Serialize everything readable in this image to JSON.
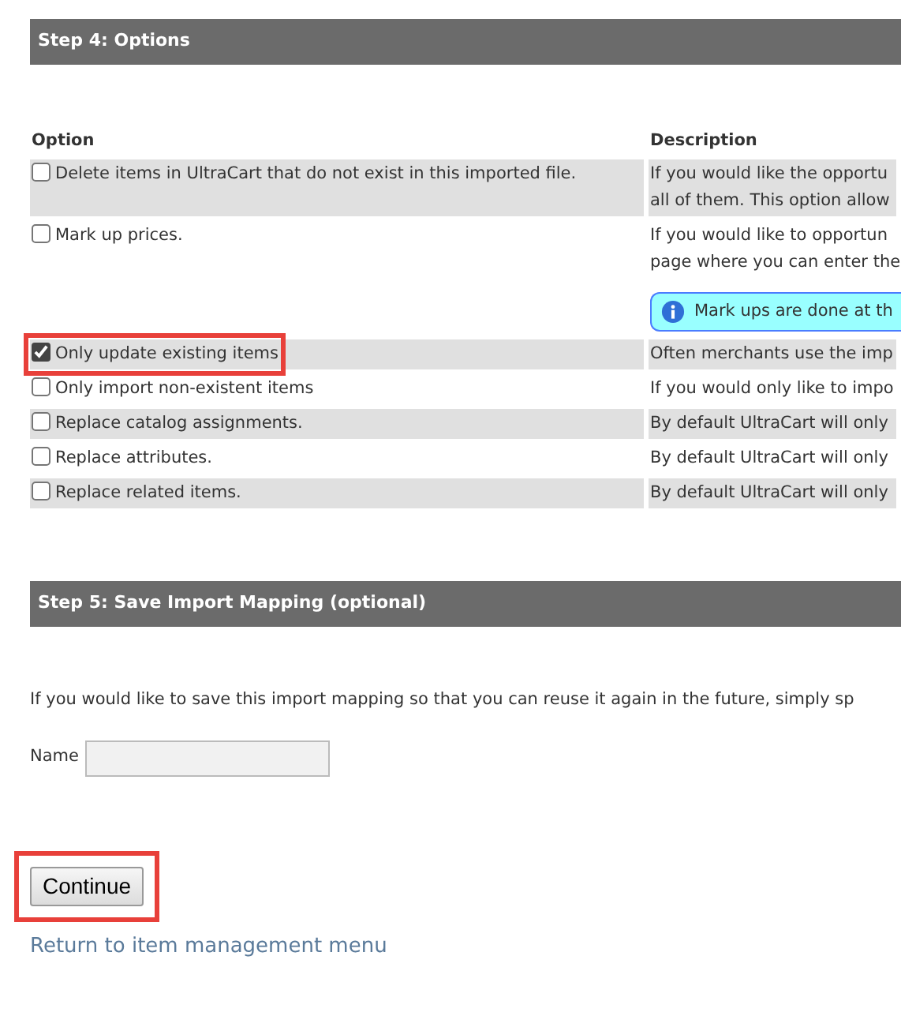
{
  "step4": {
    "title": "Step 4: Options",
    "columns": [
      "Option",
      "Description"
    ],
    "options": [
      {
        "label": "Delete items in UltraCart that do not exist in this imported file.",
        "checked": false,
        "highlighted": false,
        "description": [
          "If you would like the opportu",
          "all of them. This option allow"
        ]
      },
      {
        "label": "Mark up prices.",
        "checked": false,
        "highlighted": false,
        "description": [
          "If you would like to opportun",
          "page where you can enter the"
        ],
        "note": "Mark ups are done at th"
      },
      {
        "label": "Only update existing items",
        "checked": true,
        "highlighted": true,
        "description": [
          "Often merchants use the imp"
        ]
      },
      {
        "label": "Only import non-existent items",
        "checked": false,
        "highlighted": false,
        "description": [
          "If you would only like to impo"
        ]
      },
      {
        "label": "Replace catalog assignments.",
        "checked": false,
        "highlighted": false,
        "description": [
          "By default UltraCart will only"
        ]
      },
      {
        "label": "Replace attributes.",
        "checked": false,
        "highlighted": false,
        "description": [
          "By default UltraCart will only"
        ]
      },
      {
        "label": "Replace related items.",
        "checked": false,
        "highlighted": false,
        "description": [
          "By default UltraCart will only"
        ]
      }
    ]
  },
  "step5": {
    "title": "Step 5: Save Import Mapping (optional)",
    "intro": "If you would like to save this import mapping so that you can reuse it again in the future, simply sp",
    "name_label": "Name"
  },
  "continue_button": {
    "label": "Continue",
    "highlighted": true
  },
  "return_link": "Return to item management menu"
}
